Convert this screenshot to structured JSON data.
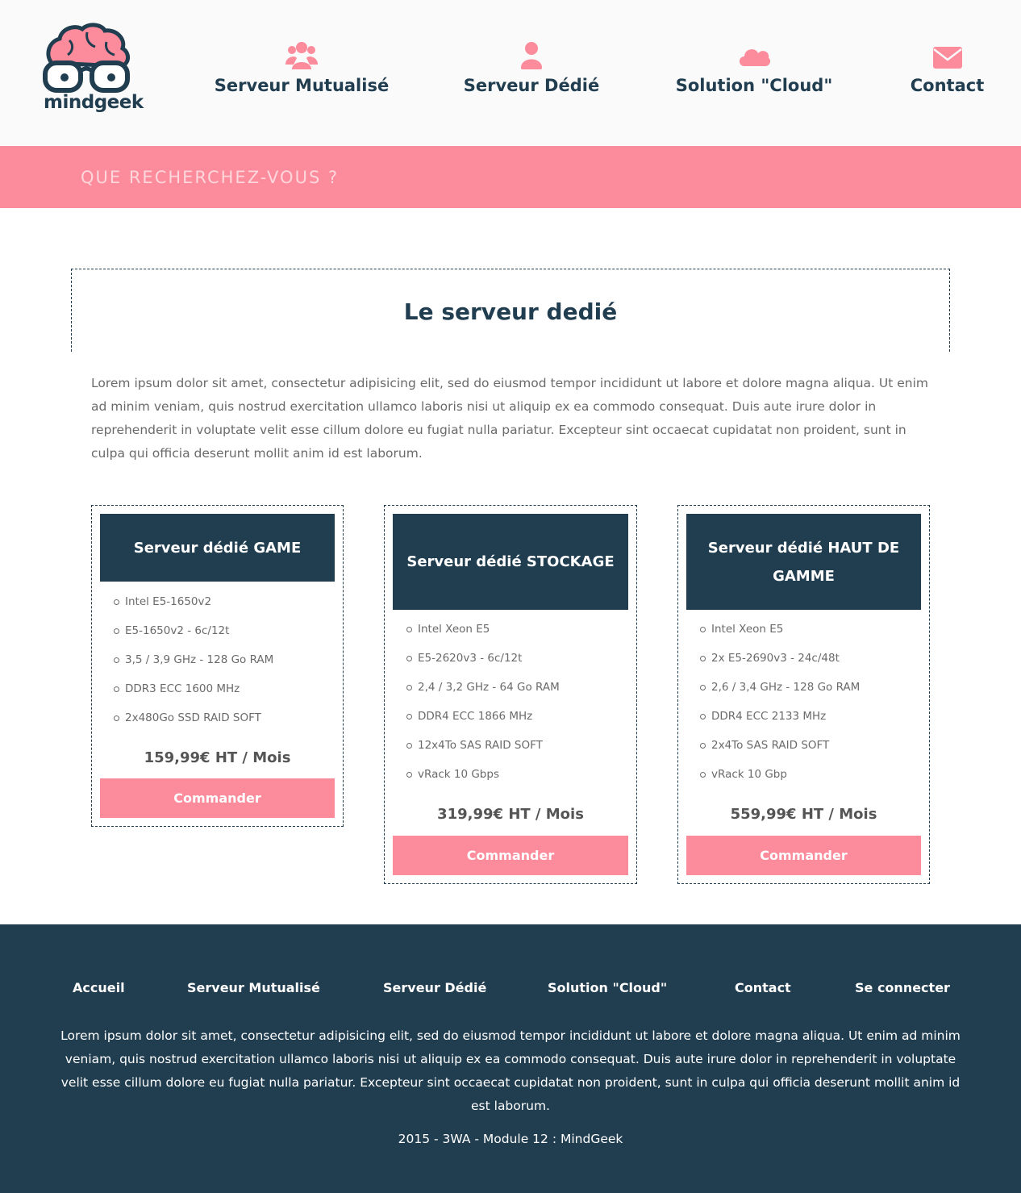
{
  "brand": {
    "name": "mindgeek",
    "accent": "#fc8b9b",
    "primary": "#213d50"
  },
  "nav": {
    "items": [
      {
        "label": "Serveur Mutualisé",
        "icon": "users-icon"
      },
      {
        "label": "Serveur Dédié",
        "icon": "user-icon"
      },
      {
        "label": "Solution \"Cloud\"",
        "icon": "cloud-icon"
      },
      {
        "label": "Contact",
        "icon": "envelope-icon"
      }
    ]
  },
  "search": {
    "placeholder": "QUE RECHERCHEZ-VOUS ?"
  },
  "main": {
    "title": "Le serveur dedié",
    "intro": "Lorem ipsum dolor sit amet, consectetur adipisicing elit, sed do eiusmod tempor incididunt ut labore et dolore magna aliqua. Ut enim ad minim veniam, quis nostrud exercitation ullamco laboris nisi ut aliquip ex ea commodo consequat. Duis aute irure dolor in reprehenderit in voluptate velit esse cillum dolore eu fugiat nulla pariatur. Excepteur sint occaecat cupidatat non proident, sunt in culpa qui officia deserunt mollit anim id est laborum."
  },
  "offers": [
    {
      "title": "Serveur dédié GAME",
      "specs": [
        "Intel E5-1650v2",
        "E5-1650v2 - 6c/12t",
        "3,5 / 3,9 GHz - 128 Go RAM",
        "DDR3 ECC 1600 MHz",
        "2x480Go SSD RAID SOFT"
      ],
      "price": "159,99€ HT / Mois",
      "button": "Commander"
    },
    {
      "title": "Serveur dédié STOCKAGE",
      "specs": [
        "Intel Xeon E5",
        "E5-2620v3 - 6c/12t",
        "2,4 / 3,2 GHz - 64 Go RAM",
        "DDR4 ECC 1866 MHz",
        "12x4To SAS RAID SOFT",
        "vRack 10 Gbps"
      ],
      "price": "319,99€ HT / Mois",
      "button": "Commander"
    },
    {
      "title": "Serveur dédié HAUT DE GAMME",
      "specs": [
        "Intel Xeon E5",
        "2x E5-2690v3 - 24c/48t",
        "2,6 / 3,4 GHz - 128 Go RAM",
        "DDR4 ECC 2133 MHz",
        "2x4To SAS RAID SOFT",
        "vRack 10 Gbp"
      ],
      "price": "559,99€ HT / Mois",
      "button": "Commander"
    }
  ],
  "footer": {
    "links": [
      "Accueil",
      "Serveur Mutualisé",
      "Serveur Dédié",
      "Solution \"Cloud\"",
      "Contact",
      "Se connecter"
    ],
    "text": "Lorem ipsum dolor sit amet, consectetur adipisicing elit, sed do eiusmod tempor incididunt ut labore et dolore magna aliqua. Ut enim ad minim veniam, quis nostrud exercitation ullamco laboris nisi ut aliquip ex ea commodo consequat. Duis aute irure dolor in reprehenderit in voluptate velit esse cillum dolore eu fugiat nulla pariatur. Excepteur sint occaecat cupidatat non proident, sunt in culpa qui officia deserunt mollit anim id est laborum.",
    "copyright": "2015 - 3WA - Module 12 : MindGeek"
  }
}
